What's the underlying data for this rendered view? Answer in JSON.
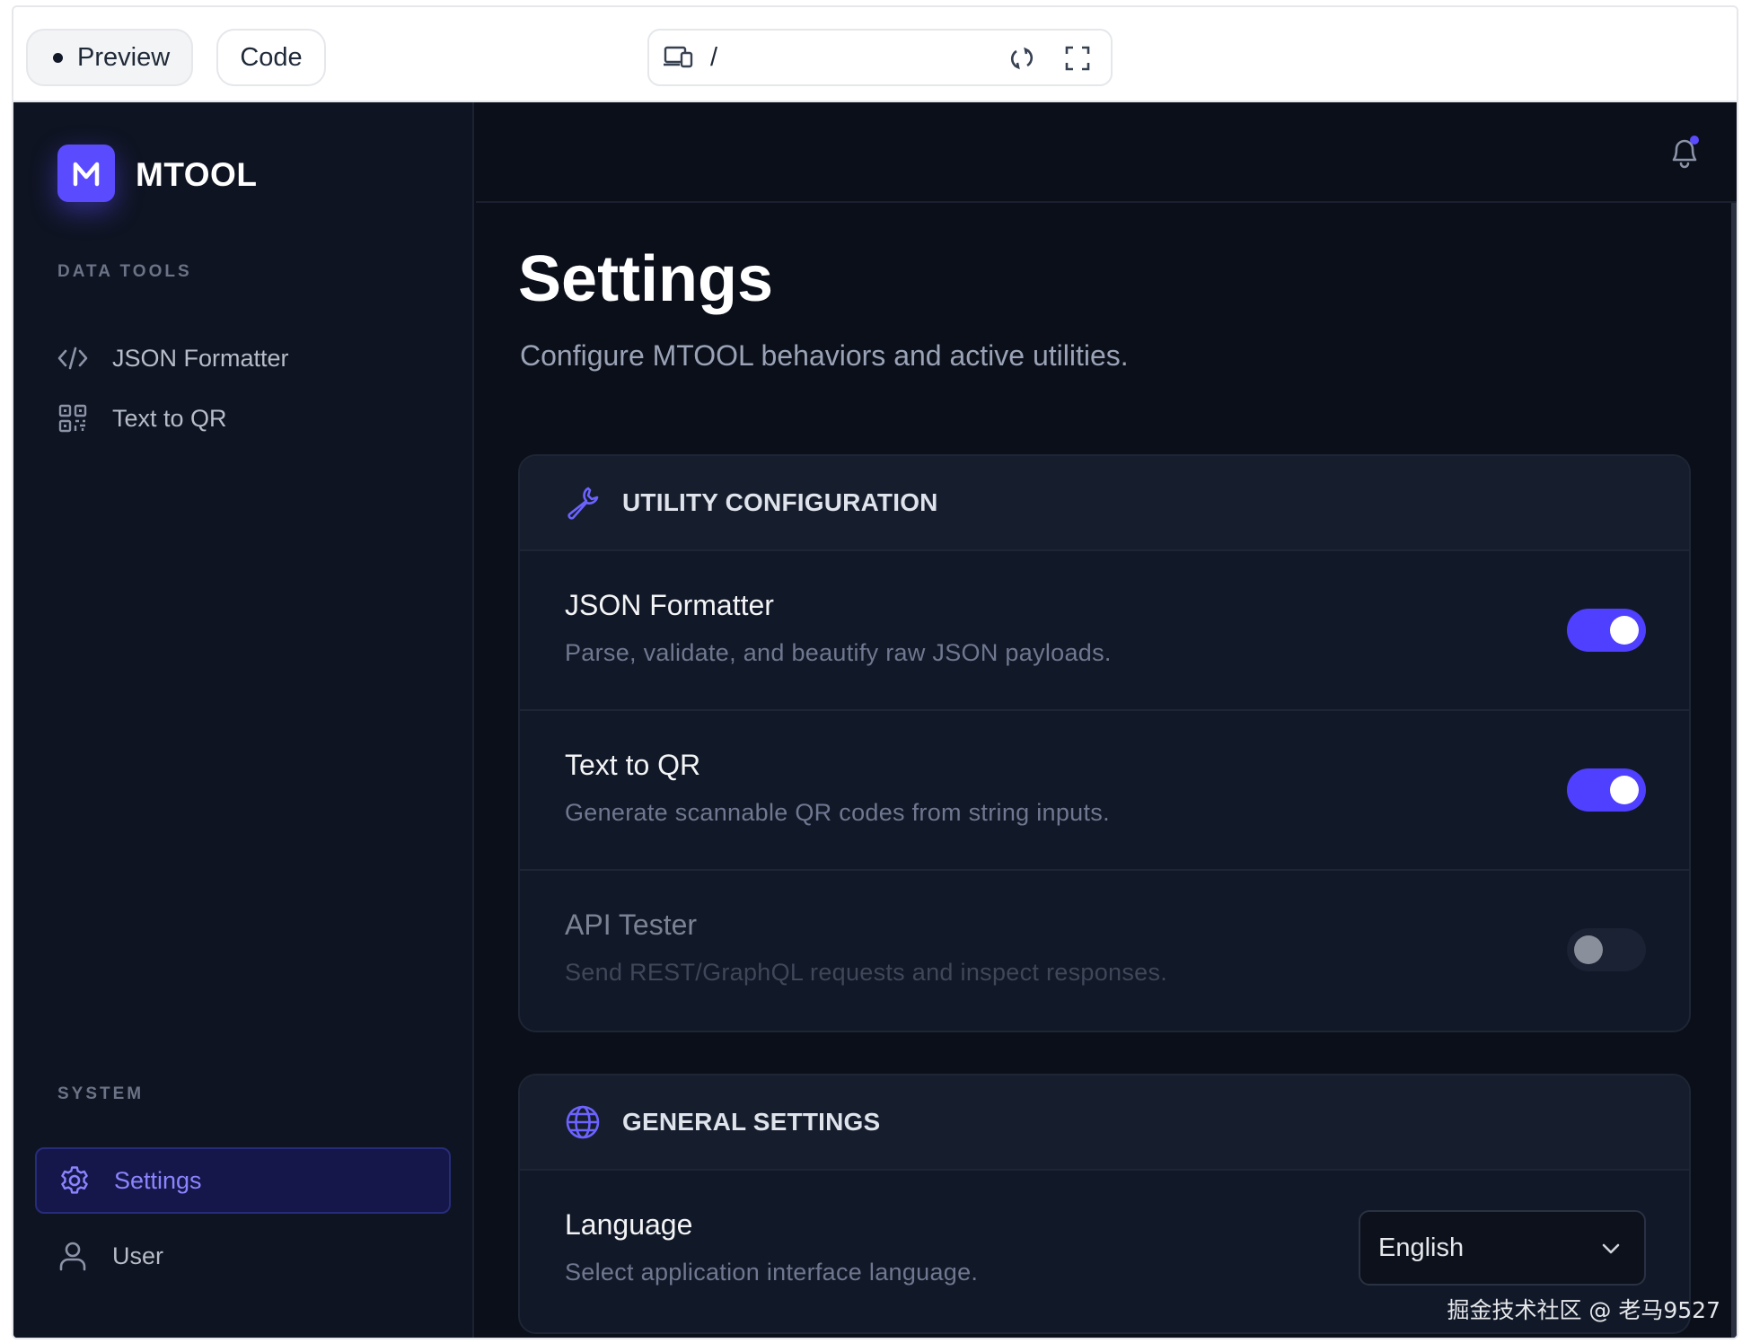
{
  "browser": {
    "preview_label": "Preview",
    "code_label": "Code",
    "address_path": "/"
  },
  "app": {
    "name": "MTOOL",
    "logo_letter": "M",
    "accent_color": "#5b4bff"
  },
  "sidebar": {
    "data_tools_label": "DATA TOOLS",
    "data_tools_items": [
      {
        "label": "JSON Formatter",
        "icon": "code-icon"
      },
      {
        "label": "Text to QR",
        "icon": "qr-code-icon"
      }
    ],
    "system_label": "SYSTEM",
    "system_items": [
      {
        "label": "Settings",
        "icon": "gear-icon",
        "active": true
      },
      {
        "label": "User",
        "icon": "user-icon",
        "active": false
      }
    ]
  },
  "main": {
    "title": "Settings",
    "subtitle": "Configure MTOOL behaviors and active utilities.",
    "utility_card": {
      "title": "UTILITY CONFIGURATION",
      "icon": "wrench-icon",
      "rows": [
        {
          "title": "JSON Formatter",
          "description": "Parse, validate, and beautify raw JSON payloads.",
          "enabled": true
        },
        {
          "title": "Text to QR",
          "description": "Generate scannable QR codes from string inputs.",
          "enabled": true
        },
        {
          "title": "API Tester",
          "description": "Send REST/GraphQL requests and inspect responses.",
          "enabled": false
        }
      ]
    },
    "general_card": {
      "title": "GENERAL SETTINGS",
      "icon": "globe-icon",
      "language": {
        "title": "Language",
        "description": "Select application interface language.",
        "selected": "English"
      }
    }
  },
  "watermark": "掘金技术社区 @ 老马9527"
}
